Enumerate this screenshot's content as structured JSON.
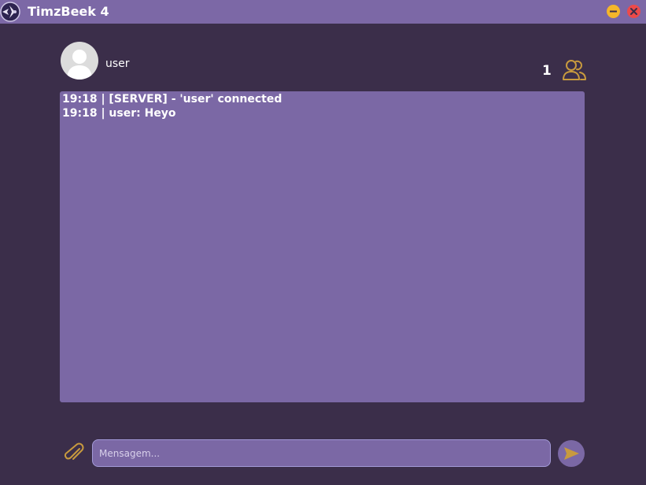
{
  "window": {
    "title": "TimzBeek 4",
    "icon": "app-logo"
  },
  "controls": {
    "minimize_icon": "minimize-icon",
    "close_icon": "close-icon"
  },
  "profile": {
    "username": "user",
    "avatar_icon": "user-avatar-icon"
  },
  "users": {
    "online_count": "1",
    "icon": "users-icon"
  },
  "chat": {
    "messages": [
      "19:18 | [SERVER] - 'user' connected",
      "19:18 | user: Heyo"
    ]
  },
  "composer": {
    "placeholder": "Mensagem...",
    "value": "",
    "attach_icon": "paperclip-icon",
    "send_icon": "send-icon"
  },
  "colors": {
    "background": "#3b2e4a",
    "panel": "#7b68a5",
    "titlebar": "#7c68a6",
    "accent": "#c89a3e",
    "minimize": "#f5b62a",
    "close": "#ec4a4a"
  }
}
